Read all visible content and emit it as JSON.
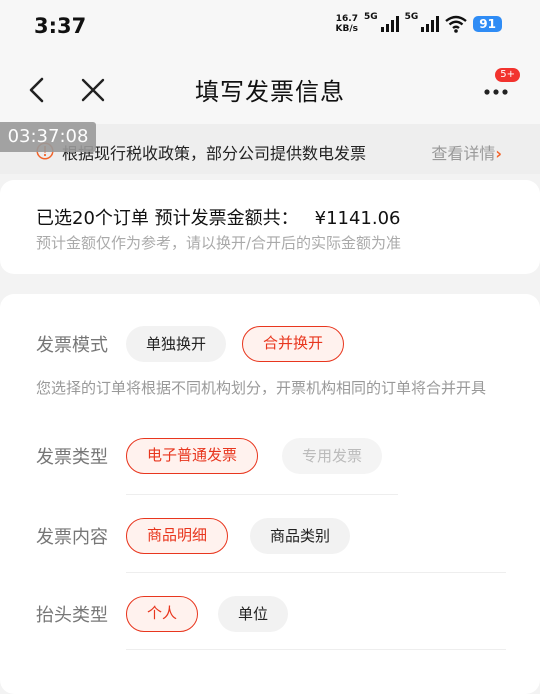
{
  "status_bar": {
    "time": "3:37",
    "net_speed_value": "16.7",
    "net_speed_unit": "KB/s",
    "signal_1": "5G",
    "signal_2": "5G",
    "battery": "91"
  },
  "nav": {
    "title": "填写发票信息",
    "more_badge": "5+"
  },
  "timestamp": "03:37:08",
  "notice": {
    "text": "根据现行税收政策，部分公司提供数电发票",
    "link": "查看详情",
    "link_arrow": "›"
  },
  "summary": {
    "main": "已选20个订单 预计发票金额共：",
    "amount": "¥1141.06",
    "sub": "预计金额仅作为参考，请以换开/合开后的实际金额为准"
  },
  "form": {
    "mode": {
      "label": "发票模式",
      "options": [
        "单独换开",
        "合并换开"
      ],
      "selected": "合并换开",
      "hint": "您选择的订单将根据不同机构划分，开票机构相同的订单将合并开具"
    },
    "type": {
      "label": "发票类型",
      "options": [
        "电子普通发票",
        "专用发票"
      ],
      "selected": "电子普通发票"
    },
    "content": {
      "label": "发票内容",
      "options": [
        "商品明细",
        "商品类别"
      ],
      "selected": "商品明细"
    },
    "header": {
      "label": "抬头类型",
      "options": [
        "个人",
        "单位"
      ],
      "selected": "个人"
    }
  },
  "colors": {
    "accent": "#e8361e",
    "accent_bg": "#fff2ee",
    "battery": "#2f8cf5",
    "badge": "#f2332e"
  }
}
